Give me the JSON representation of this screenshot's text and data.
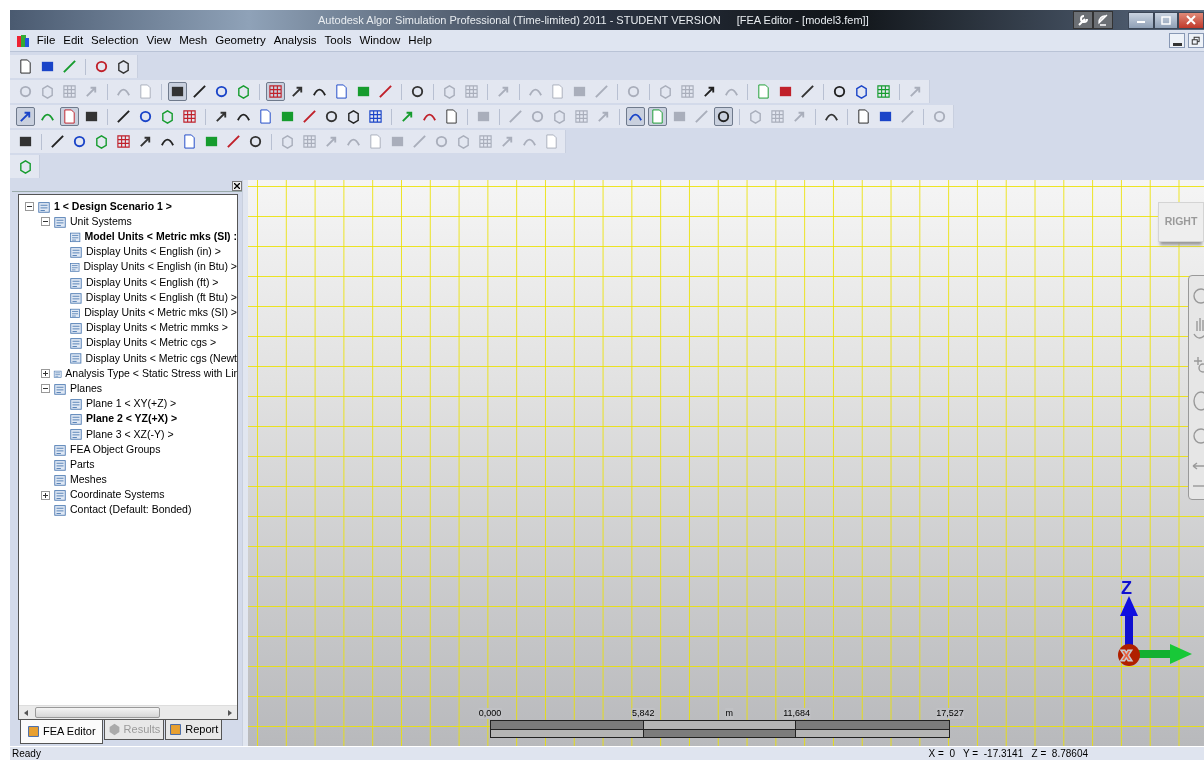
{
  "window": {
    "title": "Autodesk Algor Simulation Professional (Time-limited) 2011 - STUDENT VERSION",
    "document": "[FEA Editor - [model3.fem]]"
  },
  "menu": [
    "File",
    "Edit",
    "Selection",
    "View",
    "Mesh",
    "Geometry",
    "Analysis",
    "Tools",
    "Window",
    "Help"
  ],
  "toolbars": [
    {
      "groups": [
        [
          {
            "pressed": false,
            "disabled": false
          },
          {
            "pressed": false,
            "disabled": false
          },
          {
            "pressed": false,
            "disabled": false
          }
        ],
        [
          {
            "pressed": false,
            "disabled": false
          },
          {
            "pressed": false,
            "disabled": false
          }
        ]
      ]
    },
    {
      "groups": [
        [
          {
            "pressed": false,
            "disabled": true
          },
          {
            "pressed": false,
            "disabled": true
          },
          {
            "pressed": false,
            "disabled": true
          },
          {
            "pressed": false,
            "disabled": true
          }
        ],
        [
          {
            "pressed": false,
            "disabled": true
          },
          {
            "pressed": false,
            "disabled": true
          }
        ],
        [
          {
            "pressed": true,
            "disabled": false
          },
          {
            "pressed": false,
            "disabled": false
          },
          {
            "pressed": false,
            "disabled": false
          },
          {
            "pressed": false,
            "disabled": false
          }
        ],
        [
          {
            "pressed": true,
            "disabled": false
          },
          {
            "pressed": false,
            "disabled": false
          },
          {
            "pressed": false,
            "disabled": false
          },
          {
            "pressed": false,
            "disabled": false
          },
          {
            "pressed": false,
            "disabled": false
          },
          {
            "pressed": false,
            "disabled": false
          }
        ],
        [
          {
            "pressed": false,
            "disabled": false
          }
        ],
        [
          {
            "pressed": false,
            "disabled": true
          },
          {
            "pressed": false,
            "disabled": true
          }
        ],
        [
          {
            "pressed": false,
            "disabled": true
          }
        ],
        [
          {
            "pressed": false,
            "disabled": true
          },
          {
            "pressed": false,
            "disabled": true
          },
          {
            "pressed": false,
            "disabled": true
          },
          {
            "pressed": false,
            "disabled": true
          }
        ],
        [
          {
            "pressed": false,
            "disabled": true
          }
        ],
        [
          {
            "pressed": false,
            "disabled": true
          },
          {
            "pressed": false,
            "disabled": true
          },
          {
            "pressed": false,
            "disabled": false
          },
          {
            "pressed": false,
            "disabled": true
          }
        ],
        [
          {
            "pressed": false,
            "disabled": false
          },
          {
            "pressed": false,
            "disabled": false
          },
          {
            "pressed": false,
            "disabled": false
          }
        ],
        [
          {
            "pressed": false,
            "disabled": false
          },
          {
            "pressed": false,
            "disabled": false
          },
          {
            "pressed": false,
            "disabled": false
          }
        ],
        [
          {
            "pressed": false,
            "disabled": true
          }
        ]
      ]
    },
    {
      "groups": [
        [
          {
            "pressed": true,
            "disabled": false
          },
          {
            "pressed": false,
            "disabled": false
          },
          {
            "pressed": true,
            "disabled": false
          },
          {
            "pressed": false,
            "disabled": false
          }
        ],
        [
          {
            "pressed": false,
            "disabled": false
          },
          {
            "pressed": false,
            "disabled": false
          },
          {
            "pressed": false,
            "disabled": false
          },
          {
            "pressed": false,
            "disabled": false
          }
        ],
        [
          {
            "pressed": false,
            "disabled": false
          },
          {
            "pressed": false,
            "disabled": false
          },
          {
            "pressed": false,
            "disabled": false
          },
          {
            "pressed": false,
            "disabled": false
          },
          {
            "pressed": false,
            "disabled": false
          },
          {
            "pressed": false,
            "disabled": false
          },
          {
            "pressed": false,
            "disabled": false
          },
          {
            "pressed": false,
            "disabled": false
          }
        ],
        [
          {
            "pressed": false,
            "disabled": false
          },
          {
            "pressed": false,
            "disabled": false
          },
          {
            "pressed": false,
            "disabled": false
          }
        ],
        [
          {
            "pressed": false,
            "disabled": true
          }
        ],
        [
          {
            "pressed": false,
            "disabled": true
          },
          {
            "pressed": false,
            "disabled": true
          },
          {
            "pressed": false,
            "disabled": true
          },
          {
            "pressed": false,
            "disabled": true
          },
          {
            "pressed": false,
            "disabled": true
          }
        ],
        [
          {
            "pressed": true,
            "disabled": false
          },
          {
            "pressed": true,
            "disabled": false
          },
          {
            "pressed": false,
            "disabled": true
          },
          {
            "pressed": false,
            "disabled": true
          },
          {
            "pressed": true,
            "disabled": false
          }
        ],
        [
          {
            "pressed": false,
            "disabled": true
          },
          {
            "pressed": false,
            "disabled": true
          },
          {
            "pressed": false,
            "disabled": true
          }
        ],
        [
          {
            "pressed": false,
            "disabled": false
          }
        ],
        [
          {
            "pressed": false,
            "disabled": false
          },
          {
            "pressed": false,
            "disabled": false
          },
          {
            "pressed": false,
            "disabled": true
          }
        ],
        [
          {
            "pressed": false,
            "disabled": true
          }
        ]
      ]
    },
    {
      "groups": [
        [
          {
            "pressed": false,
            "disabled": false
          }
        ],
        [
          {
            "pressed": false,
            "disabled": false
          },
          {
            "pressed": false,
            "disabled": false
          },
          {
            "pressed": false,
            "disabled": false
          },
          {
            "pressed": false,
            "disabled": false
          },
          {
            "pressed": false,
            "disabled": false
          },
          {
            "pressed": false,
            "disabled": false
          },
          {
            "pressed": false,
            "disabled": false
          },
          {
            "pressed": false,
            "disabled": false
          },
          {
            "pressed": false,
            "disabled": false
          },
          {
            "pressed": false,
            "disabled": false
          }
        ],
        [
          {
            "pressed": false,
            "disabled": true
          },
          {
            "pressed": false,
            "disabled": true
          },
          {
            "pressed": false,
            "disabled": true
          },
          {
            "pressed": false,
            "disabled": true
          },
          {
            "pressed": false,
            "disabled": true
          },
          {
            "pressed": false,
            "disabled": true
          },
          {
            "pressed": false,
            "disabled": true
          },
          {
            "pressed": false,
            "disabled": true
          },
          {
            "pressed": false,
            "disabled": true
          },
          {
            "pressed": false,
            "disabled": true
          },
          {
            "pressed": false,
            "disabled": true
          },
          {
            "pressed": false,
            "disabled": true
          },
          {
            "pressed": false,
            "disabled": true
          }
        ]
      ]
    },
    {
      "groups": [
        [
          {
            "pressed": false,
            "disabled": false
          }
        ]
      ]
    }
  ],
  "tree": [
    {
      "label": "1 < Design Scenario 1 >",
      "active": true,
      "expanded": true,
      "children": [
        {
          "label": "Unit Systems",
          "active": false,
          "expanded": true,
          "children": [
            {
              "label": "Model Units < Metric mks (SI) :",
              "active": true
            },
            {
              "label": "Display Units < English (in) >",
              "active": false
            },
            {
              "label": "Display Units < English (in Btu) >",
              "active": false
            },
            {
              "label": "Display Units < English (ft) >",
              "active": false
            },
            {
              "label": "Display Units < English (ft Btu) >",
              "active": false
            },
            {
              "label": "Display Units < Metric mks (SI) >",
              "active": false
            },
            {
              "label": "Display Units < Metric mmks >",
              "active": false
            },
            {
              "label": "Display Units < Metric cgs >",
              "active": false
            },
            {
              "label": "Display Units < Metric cgs (Newt",
              "active": false
            }
          ]
        },
        {
          "label": "Analysis Type < Static Stress with Lir",
          "active": false,
          "expanded": false
        },
        {
          "label": "Planes",
          "active": false,
          "expanded": true,
          "children": [
            {
              "label": "Plane 1 < XY(+Z) >",
              "active": false
            },
            {
              "label": "Plane 2 < YZ(+X) >",
              "active": true
            },
            {
              "label": "Plane 3 < XZ(-Y) >",
              "active": false
            }
          ]
        },
        {
          "label": "FEA Object Groups",
          "active": false
        },
        {
          "label": "Parts",
          "active": false
        },
        {
          "label": "Meshes",
          "active": false
        },
        {
          "label": "Coordinate Systems",
          "active": false,
          "expanded": false
        },
        {
          "label": "Contact (Default: Bonded)",
          "active": false
        }
      ]
    }
  ],
  "panel_tabs": [
    {
      "label": "FEA Editor",
      "selected": true,
      "disabled": false
    },
    {
      "label": "Results",
      "selected": false,
      "disabled": true
    },
    {
      "label": "Report",
      "selected": false,
      "disabled": false
    }
  ],
  "viewport": {
    "view_cube": "RIGHT",
    "axes": [
      "Z",
      "X"
    ],
    "scale": {
      "ticks": [
        "0,000",
        "5,842",
        "11,684",
        "17,527"
      ],
      "unit": "m"
    }
  },
  "status_bar": {
    "message": "Ready",
    "coordinates": "X =  0   Y =  -17.3141   Z =  8.78604"
  }
}
